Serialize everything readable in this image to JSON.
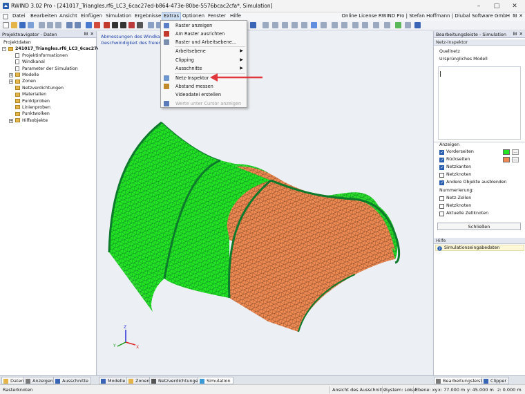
{
  "titlebar": {
    "title": "RWIND 3.02 Pro - [241017_Triangles.rf6_LC3_6cac27ed-b864-473e-80be-5576bcac2cfa*, Simulation]",
    "minimize": "–",
    "maximize": "□",
    "close": "✕"
  },
  "menu": {
    "items": [
      "Datei",
      "Bearbeiten",
      "Ansicht",
      "Einfügen",
      "Simulation",
      "Ergebnisse",
      "Extras",
      "Optionen",
      "Fenster",
      "Hilfe"
    ],
    "licence": "Online License RWIND Pro | Stefan Hoffmann | Dlubal Software GmbH",
    "pin": "₪",
    "close": "✕"
  },
  "left_panel": {
    "title": "Projektnavigator - Daten",
    "pin": "₪",
    "close": "✕",
    "tree": [
      {
        "label": "Projektdaten",
        "level": 0,
        "expander": "",
        "icon": "none"
      },
      {
        "label": "241017_Triangles.rf6_LC3_6cac27ed",
        "level": 0,
        "expander": "–",
        "icon": "folder",
        "bold": true
      },
      {
        "label": "Projektinformationen",
        "level": 1,
        "expander": "",
        "icon": "doc"
      },
      {
        "label": "Windkanal",
        "level": 1,
        "expander": "",
        "icon": "doc"
      },
      {
        "label": "Parameter der Simulation",
        "level": 1,
        "expander": "",
        "icon": "doc"
      },
      {
        "label": "Modelle",
        "level": 1,
        "expander": "+",
        "icon": "folder"
      },
      {
        "label": "Zonen",
        "level": 1,
        "expander": "+",
        "icon": "folder"
      },
      {
        "label": "Netzverdichtungen",
        "level": 1,
        "expander": "",
        "icon": "folder"
      },
      {
        "label": "Materialien",
        "level": 1,
        "expander": "",
        "icon": "folder"
      },
      {
        "label": "Punktproben",
        "level": 1,
        "expander": "",
        "icon": "folder"
      },
      {
        "label": "Linienproben",
        "level": 1,
        "expander": "",
        "icon": "folder"
      },
      {
        "label": "Punktwolken",
        "level": 1,
        "expander": "",
        "icon": "folder"
      },
      {
        "label": "Hilfsobjekte",
        "level": 1,
        "expander": "+",
        "icon": "folder"
      }
    ]
  },
  "viewport": {
    "info_line1": "Abmessungen des Windkanals:",
    "info_line2": "Geschwindigkeit des freien Strö"
  },
  "dropdown": {
    "items": [
      {
        "label": "Raster anzeigen",
        "submenu": false,
        "disabled": false,
        "icon": "grid-icon"
      },
      {
        "label": "Am Raster ausrichten",
        "submenu": false,
        "disabled": false,
        "icon": "snap-icon"
      },
      {
        "label": "Raster und Arbeitsebene...",
        "submenu": false,
        "disabled": false,
        "icon": "plane-icon"
      },
      {
        "label": "Arbeitsebene",
        "submenu": true,
        "disabled": false,
        "icon": ""
      },
      {
        "label": "Clipping",
        "submenu": true,
        "disabled": false,
        "icon": ""
      },
      {
        "label": "Ausschnitte",
        "submenu": true,
        "disabled": false,
        "icon": ""
      },
      {
        "label": "Netz-Inspektor",
        "submenu": false,
        "disabled": false,
        "icon": "mesh-icon"
      },
      {
        "label": "Abstand messen",
        "submenu": false,
        "disabled": false,
        "icon": "ruler-icon"
      },
      {
        "label": "Videodatei erstellen",
        "submenu": false,
        "disabled": false,
        "icon": ""
      },
      {
        "label": "Werte unter Cursor anzeigen",
        "submenu": false,
        "disabled": true,
        "icon": "check-icon"
      }
    ],
    "submenu_arrow": "▶"
  },
  "right_panel": {
    "title": "Bearbeitungsleiste - Simulation",
    "pin": "₪",
    "close": "✕",
    "inspector_header": "Netz-Inspektor",
    "source_label": "Quellnetz",
    "source_value": "Ursprüngliches Modell",
    "display_label": "Anzeigen",
    "options": [
      {
        "label": "Vorderseiten",
        "checked": true,
        "color": "#22e622"
      },
      {
        "label": "Rückseiten",
        "checked": true,
        "color": "#f08a52"
      },
      {
        "label": "Netzkanten",
        "checked": true
      },
      {
        "label": "Netzknoten",
        "checked": false
      },
      {
        "label": "Andere Objekte ausblenden",
        "checked": true
      }
    ],
    "numbering_label": "Nummerierung:",
    "numbering": [
      {
        "label": "Netz-Zellen",
        "checked": false
      },
      {
        "label": "Netzknoten",
        "checked": false
      },
      {
        "label": "Aktuelle Zellknoten",
        "checked": false
      }
    ],
    "dots": "...",
    "close_button": "Schließen",
    "help_header": "Hilfe",
    "help_item": "Simulationseingabedaten"
  },
  "bottom_tabs_left": [
    "Daten",
    "Anzeigen",
    "Ausschnitte"
  ],
  "bottom_tabs_center": [
    "Modelle",
    "Zonen",
    "Netzverdichtungen",
    "Simulation"
  ],
  "bottom_tabs_right": [
    "Bearbeitungsleiste",
    "Clipper"
  ],
  "statusbar": {
    "left": "Rasterknoten",
    "view": "Ansicht des Ausschnitts",
    "system": "System: Lokal",
    "plane": "Ebene: xy",
    "x": "x: 77.000 m",
    "y": "y: 45.000 m",
    "z": "z: 0.000 m"
  },
  "axes": {
    "x": "X",
    "y": "Y",
    "z": "Z"
  },
  "colors": {
    "front": "#22e622",
    "back": "#f08a52",
    "accent": "#2a5fb0",
    "annotation_arrow": "#e0353a"
  }
}
